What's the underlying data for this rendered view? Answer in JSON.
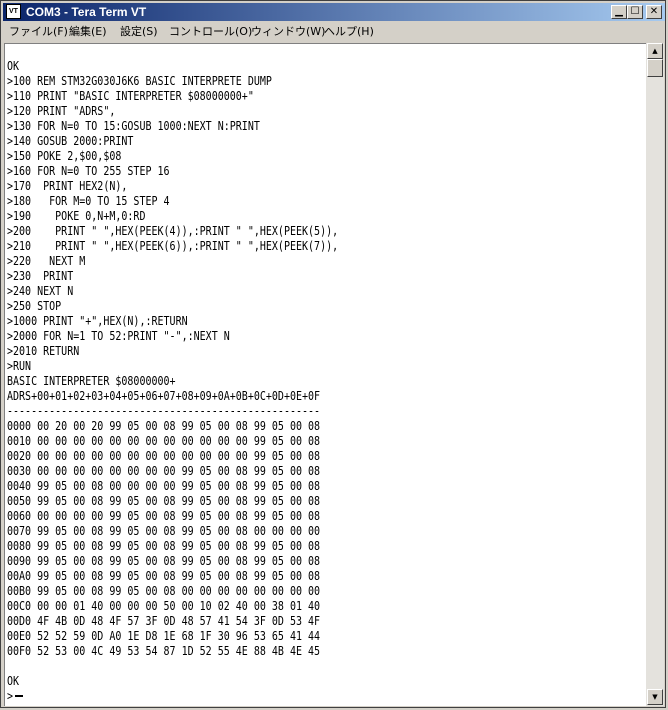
{
  "window": {
    "title": "COM3 - Tera Term VT",
    "icon_text": "VT"
  },
  "menu": [
    "ファイル(F)",
    "編集(E)",
    "設定(S)",
    "コントロール(O)",
    "ウィンドウ(W)",
    "ヘルプ(H)"
  ],
  "terminal": {
    "lines": [
      "OK",
      ">100 REM STM32G030J6K6 BASIC INTERPRETE DUMP",
      ">110 PRINT \"BASIC INTERPRETER $08000000+\"",
      ">120 PRINT \"ADRS\",",
      ">130 FOR N=0 TO 15:GOSUB 1000:NEXT N:PRINT",
      ">140 GOSUB 2000:PRINT",
      ">150 POKE 2,$00,$08",
      ">160 FOR N=0 TO 255 STEP 16",
      ">170  PRINT HEX2(N),",
      ">180   FOR M=0 TO 15 STEP 4",
      ">190    POKE 0,N+M,0:RD",
      ">200    PRINT \" \",HEX(PEEK(4)),:PRINT \" \",HEX(PEEK(5)),",
      ">210    PRINT \" \",HEX(PEEK(6)),:PRINT \" \",HEX(PEEK(7)),",
      ">220   NEXT M",
      ">230  PRINT",
      ">240 NEXT N",
      ">250 STOP",
      ">1000 PRINT \"+\",HEX(N),:RETURN",
      ">2000 FOR N=1 TO 52:PRINT \"-\",:NEXT N",
      ">2010 RETURN",
      ">RUN",
      "BASIC INTERPRETER $08000000+",
      "ADRS+00+01+02+03+04+05+06+07+08+09+0A+0B+0C+0D+0E+0F",
      "----------------------------------------------------",
      "0000 00 20 00 20 99 05 00 08 99 05 00 08 99 05 00 08",
      "0010 00 00 00 00 00 00 00 00 00 00 00 00 99 05 00 08",
      "0020 00 00 00 00 00 00 00 00 00 00 00 00 99 05 00 08",
      "0030 00 00 00 00 00 00 00 00 99 05 00 08 99 05 00 08",
      "0040 99 05 00 08 00 00 00 00 99 05 00 08 99 05 00 08",
      "0050 99 05 00 08 99 05 00 08 99 05 00 08 99 05 00 08",
      "0060 00 00 00 00 99 05 00 08 99 05 00 08 99 05 00 08",
      "0070 99 05 00 08 99 05 00 08 99 05 00 08 00 00 00 00",
      "0080 99 05 00 08 99 05 00 08 99 05 00 08 99 05 00 08",
      "0090 99 05 00 08 99 05 00 08 99 05 00 08 99 05 00 08",
      "00A0 99 05 00 08 99 05 00 08 99 05 00 08 99 05 00 08",
      "00B0 99 05 00 08 99 05 00 08 00 00 00 00 00 00 00 00",
      "00C0 00 00 01 40 00 00 00 50 00 10 02 40 00 38 01 40",
      "00D0 4F 4B 0D 48 4F 57 3F 0D 48 57 41 54 3F 0D 53 4F",
      "00E0 52 52 59 0D A0 1E D8 1E 68 1F 30 96 53 65 41 44",
      "00F0 52 53 00 4C 49 53 54 87 1D 52 55 4E 88 4B 4E 45",
      "",
      "OK",
      ">"
    ]
  }
}
